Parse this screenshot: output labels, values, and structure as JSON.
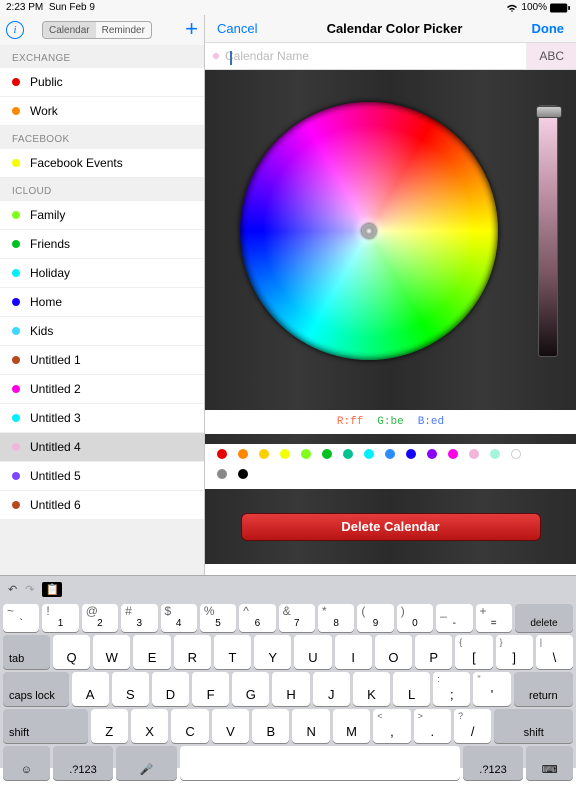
{
  "status": {
    "time": "2:23 PM",
    "date": "Sun Feb 9",
    "battery_pct": "100%"
  },
  "sidebar": {
    "tabs": {
      "calendar": "Calendar",
      "reminder": "Reminder"
    },
    "groups": [
      {
        "name": "EXCHANGE",
        "items": [
          {
            "label": "Public",
            "color": "#e60000"
          },
          {
            "label": "Work",
            "color": "#ff8800"
          }
        ]
      },
      {
        "name": "FACEBOOK",
        "items": [
          {
            "label": "Facebook Events",
            "color": "#f2ff00"
          }
        ]
      },
      {
        "name": "ICLOUD",
        "items": [
          {
            "label": "Family",
            "color": "#7fff1a"
          },
          {
            "label": "Friends",
            "color": "#00c221"
          },
          {
            "label": "Holiday",
            "color": "#00f0ff"
          },
          {
            "label": "Home",
            "color": "#1500ff"
          },
          {
            "label": "Kids",
            "color": "#3bd7ff"
          },
          {
            "label": "Untitled 1",
            "color": "#b64a1e"
          },
          {
            "label": "Untitled 2",
            "color": "#ff00e6"
          },
          {
            "label": "Untitled 3",
            "color": "#00f0ff"
          },
          {
            "label": "Untitled 4",
            "color": "#f2b6db",
            "selected": true
          },
          {
            "label": "Untitled 5",
            "color": "#7a49ff"
          },
          {
            "label": "Untitled 6",
            "color": "#b64a1e"
          }
        ]
      }
    ]
  },
  "header": {
    "cancel": "Cancel",
    "title": "Calendar Color Picker",
    "done": "Done"
  },
  "name": {
    "placeholder": "Calendar Name",
    "abc": "ABC",
    "value": ""
  },
  "rgb": {
    "r": "R:ff",
    "g": "G:be",
    "b": "B:ed"
  },
  "swatches": {
    "row1": [
      "#e60000",
      "#ff8800",
      "#ffd000",
      "#f2ff00",
      "#7fff1a",
      "#00c221",
      "#00c28e",
      "#00f0ff",
      "#2a8cff",
      "#1500ff",
      "#8b00ff",
      "#ff00e6",
      "#f2b6db",
      "#a7f5d8",
      "#ffffff"
    ],
    "row2": [
      "#888888",
      "#000000"
    ]
  },
  "delete_label": "Delete Calendar",
  "kb": {
    "delete": "delete",
    "tab": "tab",
    "caps": "caps lock",
    "return": "return",
    "shift": "shift",
    "alt": ".?123",
    "row_num_top": [
      "~",
      "!",
      "@",
      "#",
      "$",
      "%",
      "^",
      "&",
      "*",
      "(",
      ")",
      "_",
      "+"
    ],
    "row_num_main": [
      "`",
      "1",
      "2",
      "3",
      "4",
      "5",
      "6",
      "7",
      "8",
      "9",
      "0",
      "-",
      "="
    ],
    "row_q": [
      "Q",
      "W",
      "E",
      "R",
      "T",
      "Y",
      "U",
      "I",
      "O",
      "P"
    ],
    "row_q_sym_top": [
      "{",
      "}",
      "|"
    ],
    "row_q_sym_main": [
      "[",
      "]",
      "\\"
    ],
    "row_a": [
      "A",
      "S",
      "D",
      "F",
      "G",
      "H",
      "J",
      "K",
      "L"
    ],
    "row_a_sym_top": [
      ":",
      "\""
    ],
    "row_a_sym_main": [
      ";",
      "'"
    ],
    "row_z": [
      "Z",
      "X",
      "C",
      "V",
      "B",
      "N",
      "M"
    ],
    "row_z_sym_top": [
      "<",
      ">",
      "?"
    ],
    "row_z_sym_main": [
      ",",
      ".",
      "/"
    ]
  }
}
